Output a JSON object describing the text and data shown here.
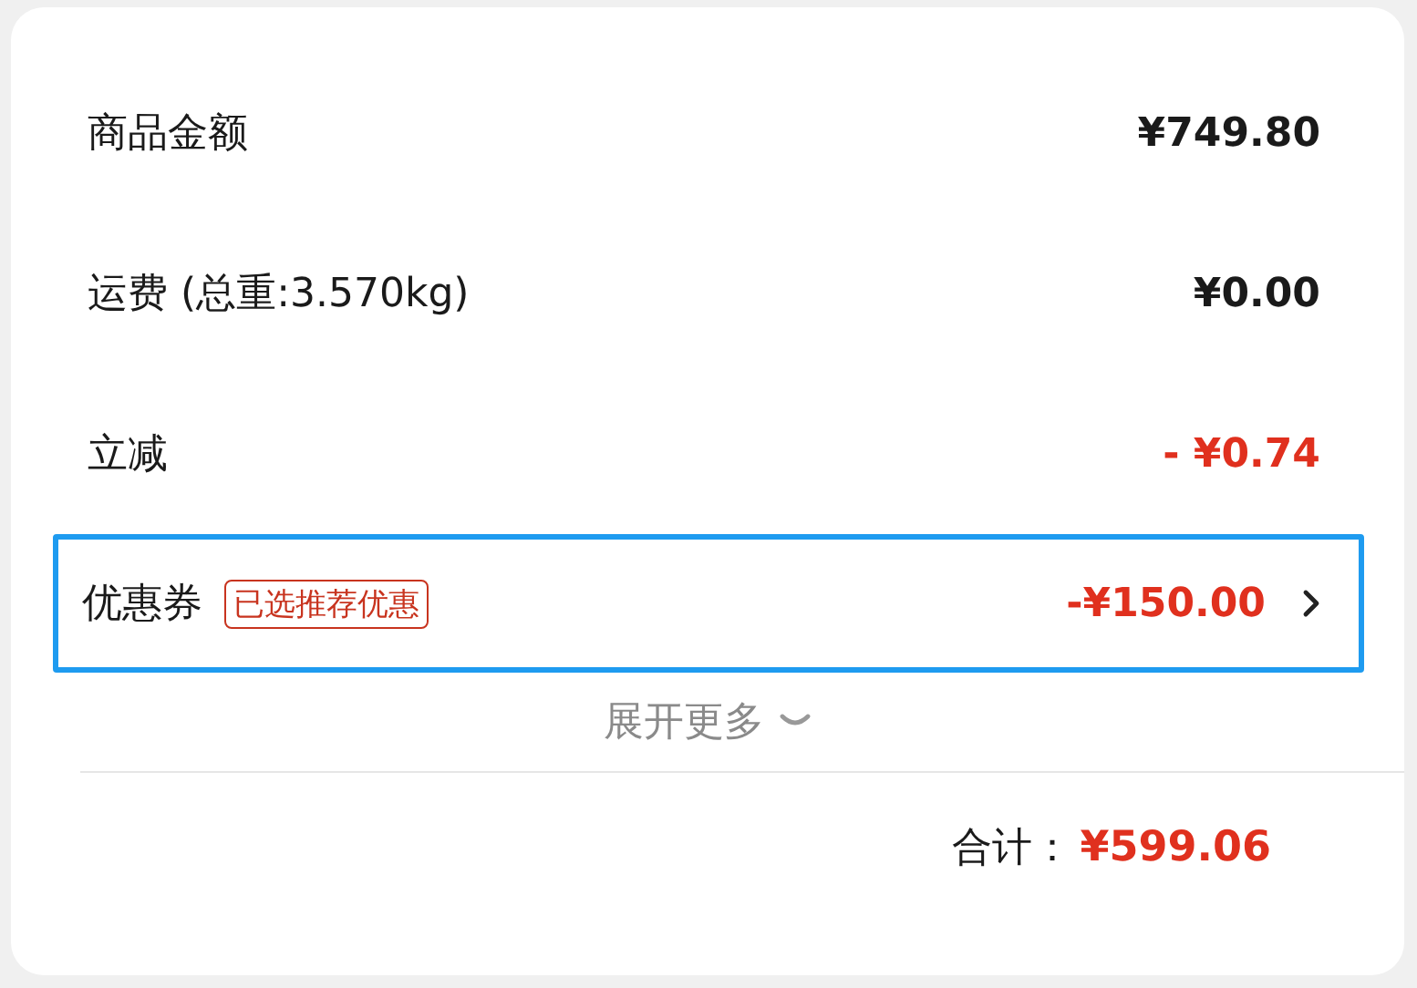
{
  "rows": [
    {
      "label": "商品金额",
      "value": "¥749.80",
      "kind": "normal",
      "selected": false
    },
    {
      "label": "运费 (总重:3.570kg)",
      "value": "¥0.00",
      "kind": "normal",
      "selected": false
    },
    {
      "label": "立减",
      "value": "- ¥0.74",
      "kind": "discount",
      "selected": false
    },
    {
      "label": "优惠券",
      "tag": "已选推荐优惠",
      "value": "-¥150.00",
      "kind": "discount",
      "selected": true,
      "has_arrow": true
    }
  ],
  "expand": {
    "label": "展开更多"
  },
  "total": {
    "label": "合计：",
    "value": "¥599.06"
  }
}
